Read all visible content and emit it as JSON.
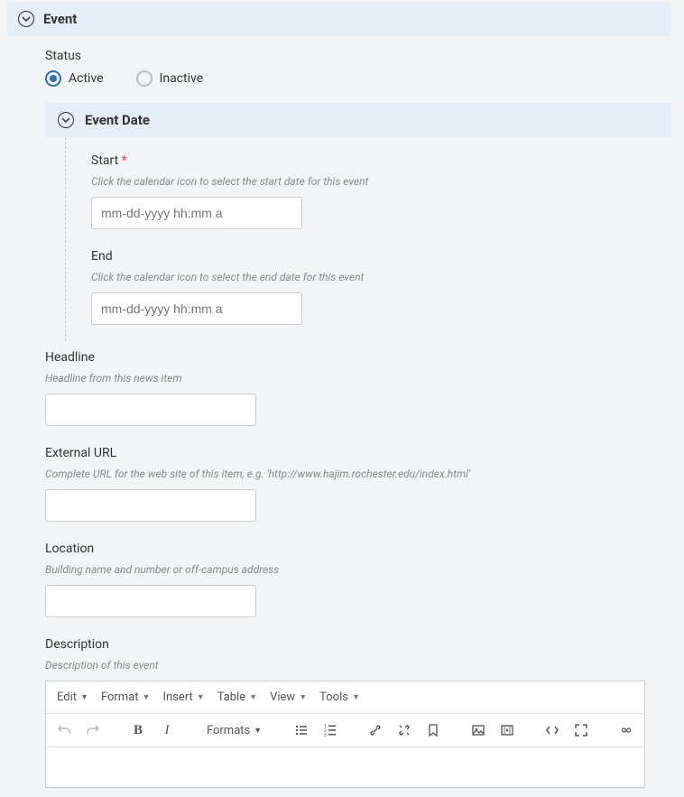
{
  "event": {
    "title": "Event",
    "status": {
      "label": "Status",
      "active": "Active",
      "inactive": "Inactive"
    },
    "eventDate": {
      "title": "Event Date",
      "start": {
        "label": "Start",
        "help": "Click the calendar icon to select the start date for this event",
        "placeholder": "mm-dd-yyyy hh:mm a"
      },
      "end": {
        "label": "End",
        "help": "Click the calendar icon to select the end date for this event",
        "placeholder": "mm-dd-yyyy hh:mm a"
      }
    },
    "headline": {
      "label": "Headline",
      "help": "Headline from this news item"
    },
    "externalUrl": {
      "label": "External URL",
      "help": "Complete URL for the web site of this item, e.g. 'http://www.hajim.rochester.edu/index.html'"
    },
    "location": {
      "label": "Location",
      "help": "Building name and number or off-campus address"
    },
    "description": {
      "label": "Description",
      "help": "Description of this event"
    }
  },
  "editor": {
    "menus": {
      "edit": "Edit",
      "format": "Format",
      "insert": "Insert",
      "table": "Table",
      "view": "View",
      "tools": "Tools"
    },
    "formats": "Formats"
  }
}
